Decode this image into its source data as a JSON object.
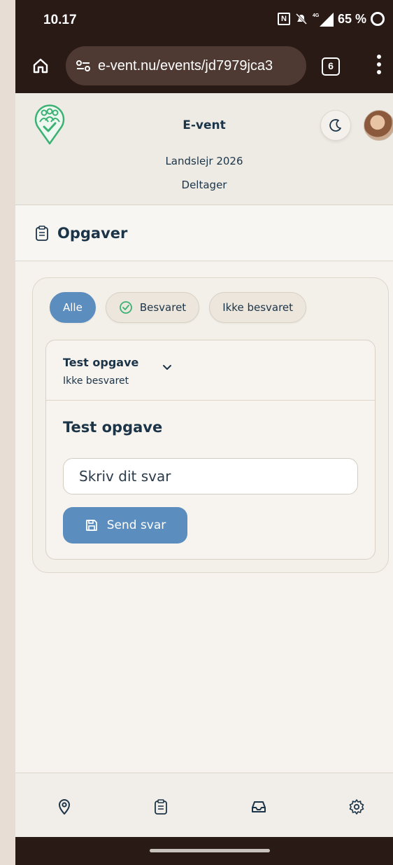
{
  "status_bar": {
    "time": "10.17",
    "network": "4G",
    "battery": "65 %"
  },
  "browser": {
    "url": "e-vent.nu/events/jd7979jca3",
    "tab_count": "6"
  },
  "app": {
    "title": "E-vent",
    "event_name": "Landslejr 2026",
    "role": "Deltager"
  },
  "section": {
    "title": "Opgaver"
  },
  "filters": [
    {
      "label": "Alle",
      "active": true
    },
    {
      "label": "Besvaret",
      "active": false
    },
    {
      "label": "Ikke besvaret",
      "active": false
    }
  ],
  "task": {
    "name": "Test opgave",
    "status": "Ikke besvaret",
    "title": "Test opgave",
    "answer_placeholder": "Skriv dit svar",
    "answer_value": "",
    "send_label": "Send svar"
  },
  "colors": {
    "accent": "#5b8dbf",
    "text": "#1c3448",
    "logo": "#3bb273",
    "check": "#3bb273",
    "chrome": "#2a1a16"
  },
  "bottom_nav": [
    {
      "icon": "location-pin-icon"
    },
    {
      "icon": "clipboard-icon"
    },
    {
      "icon": "inbox-icon"
    },
    {
      "icon": "gear-icon"
    }
  ]
}
